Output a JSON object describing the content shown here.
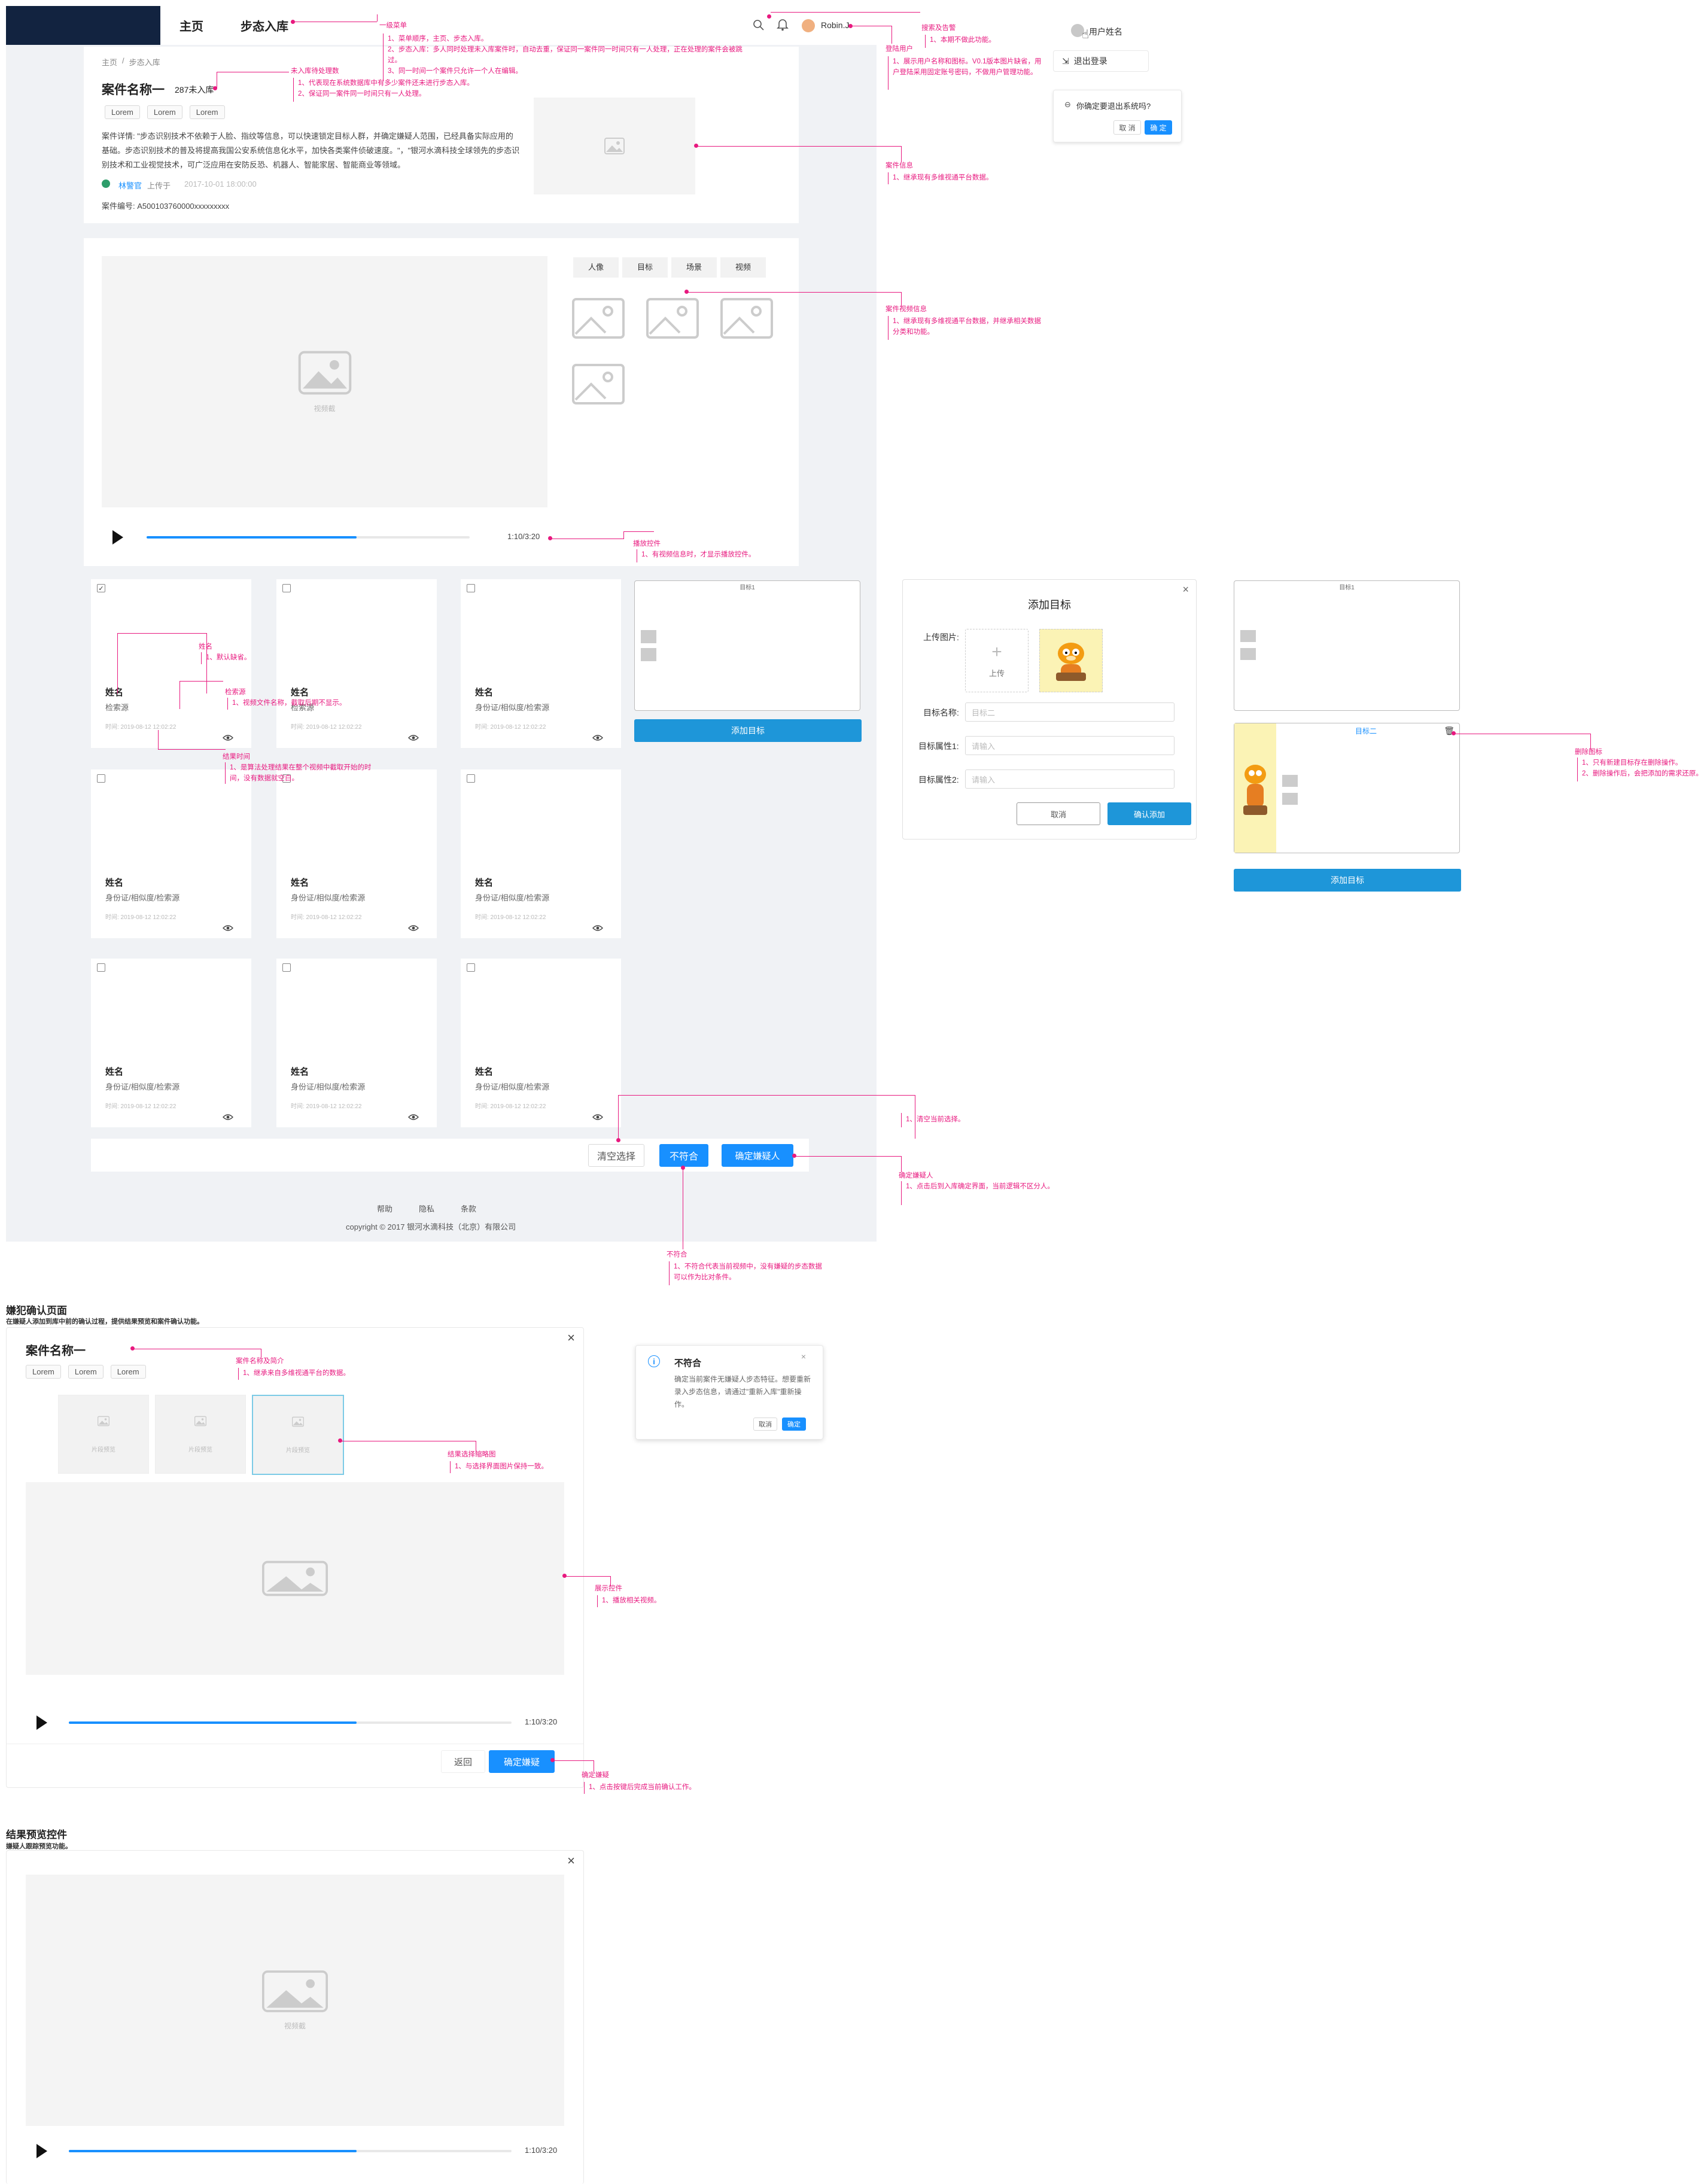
{
  "header": {
    "nav_home": "主页",
    "nav_step": "步态入库",
    "user_name": "Robin.J"
  },
  "profile_menu": {
    "username": "用户姓名",
    "logout": "退出登录",
    "confirm_question": "你确定要退出系统吗?",
    "cancel": "取 消",
    "ok": "确 定"
  },
  "case": {
    "breadcrumb": [
      "主页",
      "/",
      "步态入库"
    ],
    "title": "案件名称一",
    "pending_count": "287未入库",
    "tags": [
      "Lorem",
      "Lorem",
      "Lorem"
    ],
    "description": "案件详情: \"步态识别技术不依赖于人脸、指纹等信息，可以快速锁定目标人群，并确定嫌疑人范围，已经具备实际应用的基础。步态识别技术的普及将提高我国公安系统信息化水平，加快各类案件侦破速度。\"，\"银河水滴科技全球领先的步态识别技术和工业视觉技术，可广泛应用在安防反恐、机器人、智能家居、智能商业等领域。",
    "uploader": "林警官",
    "uploaded_at_label": "上传于",
    "uploaded_at": "2017-10-01 18:00:00",
    "case_id": "案件编号:  A500103760000xxxxxxxxx"
  },
  "video": {
    "tabs": [
      "人像",
      "目标",
      "场景",
      "视频"
    ],
    "main_caption": "视频截",
    "time": "1:10/3:20",
    "progress": 0.65
  },
  "suspects": {
    "cards": [
      {
        "name": "姓名",
        "meta": "检索源",
        "time": "时间: 2019-08-12 12:02:22",
        "checked": true
      },
      {
        "name": "姓名",
        "meta": "检索源",
        "time": "时间: 2019-08-12 12:02:22",
        "checked": false
      },
      {
        "name": "姓名",
        "meta": "身份证/相似度/检索源",
        "time": "时间: 2019-08-12 12:02:22",
        "checked": false
      },
      {
        "name": "姓名",
        "meta": "身份证/相似度/检索源",
        "time": "时间: 2019-08-12 12:02:22",
        "checked": false
      },
      {
        "name": "姓名",
        "meta": "身份证/相似度/检索源",
        "time": "时间: 2019-08-12 12:02:22",
        "checked": false
      },
      {
        "name": "姓名",
        "meta": "身份证/相似度/检索源",
        "time": "时间: 2019-08-12 12:02:22",
        "checked": false
      },
      {
        "name": "姓名",
        "meta": "身份证/相似度/检索源",
        "time": "时间: 2019-08-12 12:02:22",
        "checked": false
      },
      {
        "name": "姓名",
        "meta": "身份证/相似度/检索源",
        "time": "时间: 2019-08-12 12:02:22",
        "checked": false
      },
      {
        "name": "姓名",
        "meta": "身份证/相似度/检索源",
        "time": "时间: 2019-08-12 12:02:22",
        "checked": false
      }
    ],
    "target_panel_title": "目标1",
    "add_target": "添加目标",
    "clear": "清空选择",
    "reject": "不符合",
    "confirm": "确定嫌疑人"
  },
  "footer": {
    "links": [
      "帮助",
      "隐私",
      "条款"
    ],
    "copyright": "copyright © 2017 银河水滴科技（北京）有限公司"
  },
  "add_target_dialog": {
    "title": "添加目标",
    "upload_label": "上传图片:",
    "upload_btn": "上传",
    "name_label": "目标名称:",
    "name_value": "目标二",
    "attr1_label": "目标属性1:",
    "attr2_label": "目标属性2:",
    "placeholder": "请输入",
    "cancel": "取消",
    "confirm": "确认添加"
  },
  "target_preview": {
    "panel1_title": "目标1",
    "panel2_title": "目标二",
    "add_target": "添加目标"
  },
  "reject_popup": {
    "title": "不符合",
    "body": "确定当前案件无嫌疑人步态特征。想要重新录入步态信息，请通过\"重新入库\"重新操作。",
    "cancel": "取消",
    "ok": "确定"
  },
  "confirm_section": {
    "heading": "嫌犯确认页面",
    "subheading": "在嫌疑人添加到库中前的确认过程，提供结果预览和案件确认功能。",
    "title": "案件名称一",
    "tags": [
      "Lorem",
      "Lorem",
      "Lorem"
    ],
    "thumbs": [
      "片段预览",
      "片段预览",
      "片段预览"
    ],
    "time": "1:10/3:20",
    "progress": 0.65,
    "back": "返回",
    "confirm": "确定嫌疑"
  },
  "preview_section": {
    "heading": "结果预览控件",
    "subheading": "嫌疑人跟踪预览功能。",
    "caption": "视频截",
    "time": "1:10/3:20",
    "progress": 0.65
  },
  "annotations": {
    "a_nav_title": "一级菜单",
    "a_nav_body": "1、菜单顺序，主页、步态入库。\n2、步态入库：多人同时处理未入库案件时，自动去重，保证同一案件同一时间只有一人处理，正在处理的案件会被跳过。\n3、同一时间一个案件只允许一个人在编辑。",
    "a_count_title": "未入库待处理数",
    "a_count_body": "1、代表现在系统数据库中有多少案件还未进行步态入库。\n2、保证同一案件同一时间只有一人处理。",
    "a_search_title": "搜索及告警",
    "a_search_body": "1、本期不做此功能。",
    "a_user_title": "登陆用户",
    "a_user_body": "1、展示用户名称和图标。V0.1版本图片缺省，用户登陆采用固定账号密码，不做用户管理功能。",
    "a_caseinfo_title": "案件信息",
    "a_caseinfo_body": "1、继承现有多维视通平台数据。",
    "a_casevideo_title": "案件视频信息",
    "a_casevideo_body": "1、继承现有多维视通平台数据，并继承相关数据分类和功能。",
    "a_player_title": "播放控件",
    "a_player_body": "1、有视频信息时，才显示播放控件。",
    "a_name_title": "姓名",
    "a_name_body": "1、默认缺省。",
    "a_src_title": "检索源",
    "a_src_body": "1、视频文件名称，截取后期不显示。",
    "a_time_title": "结果时间",
    "a_time_body": "1、是算法处理结果在整个视频中截取开始的时间，没有数据就空白。",
    "a_clear_body": "1、清空当前选择。",
    "a_confirm_title": "确定嫌疑人",
    "a_confirm_body": "1、点击后到入库确定界面，当前逻辑不区分人。",
    "a_reject_title": "不符合",
    "a_reject_body": "1、不符合代表当前视频中，没有嫌疑的步态数据可以作为比对条件。",
    "a_delete_title": "删除图标",
    "a_delete_body": "1、只有新建目标存在删除操作。\n2、删除操作后，会把添加的需求还原。",
    "a_cs_title": "案件名称及简介",
    "a_cs_body": "1、继承来自多维视通平台的数据。",
    "a_thumb_title": "结果选择缩略图",
    "a_thumb_body": "1、与选择界面图片保持一致。",
    "a_cs_player_title": "展示控件",
    "a_cs_player_body": "1、播放相关视频。",
    "a_cs_confirm_title": "确定嫌疑",
    "a_cs_confirm_body": "1、点击按键后完成当前确认工作。"
  }
}
